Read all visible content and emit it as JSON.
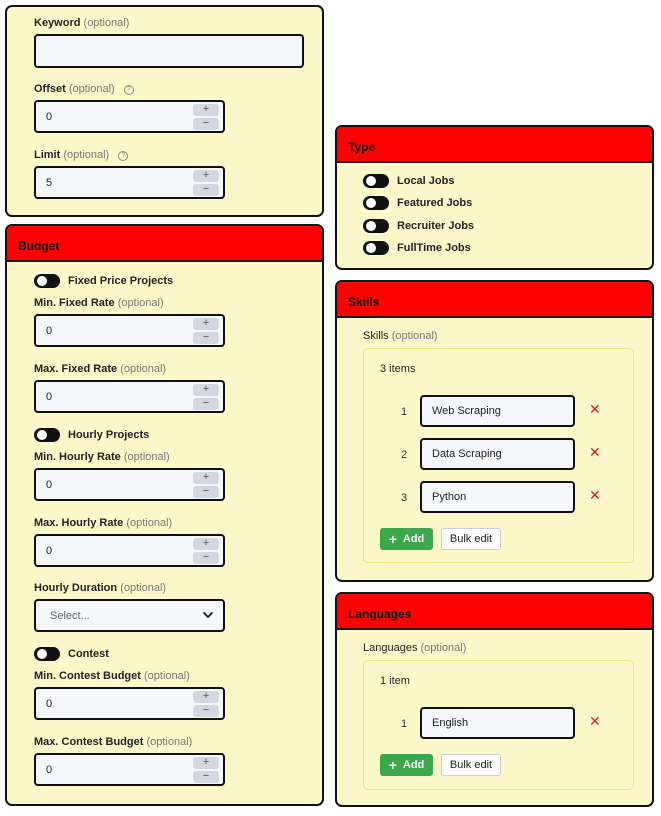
{
  "search": {
    "keyword": {
      "label": "Keyword",
      "optional": "(optional)",
      "value": ""
    },
    "offset": {
      "label": "Offset",
      "optional": "(optional)",
      "value": "0"
    },
    "limit": {
      "label": "Limit",
      "optional": "(optional)",
      "value": "5"
    }
  },
  "stepper": {
    "plus": "+",
    "minus": "−"
  },
  "help_glyph": "?",
  "budget": {
    "title": "Budget",
    "fixed_toggle": "Fixed Price Projects",
    "min_fixed": {
      "label": "Min. Fixed Rate",
      "optional": "(optional)",
      "value": "0"
    },
    "max_fixed": {
      "label": "Max. Fixed Rate",
      "optional": "(optional)",
      "value": "0"
    },
    "hourly_toggle": "Hourly Projects",
    "min_hourly": {
      "label": "Min. Hourly Rate",
      "optional": "(optional)",
      "value": "0"
    },
    "max_hourly": {
      "label": "Max. Hourly Rate",
      "optional": "(optional)",
      "value": "0"
    },
    "hourly_duration": {
      "label": "Hourly Duration",
      "optional": "(optional)",
      "placeholder": "Select..."
    },
    "contest_toggle": "Contest",
    "min_contest": {
      "label": "Min. Contest Budget",
      "optional": "(optional)",
      "value": "0"
    },
    "max_contest": {
      "label": "Max. Contest Budget",
      "optional": "(optional)",
      "value": "0"
    }
  },
  "type": {
    "title": "Type",
    "toggles": [
      "Local Jobs",
      "Featured Jobs",
      "Recruiter Jobs",
      "FullTime Jobs"
    ]
  },
  "skills": {
    "title": "Skills",
    "label": "Skills",
    "optional": "(optional)",
    "count": "3 items",
    "items": [
      {
        "num": "1",
        "value": "Web Scraping"
      },
      {
        "num": "2",
        "value": "Data Scraping"
      },
      {
        "num": "3",
        "value": "Python"
      }
    ],
    "add_label": "Add",
    "bulk_label": "Bulk edit"
  },
  "languages": {
    "title": "Languages",
    "label": "Languages",
    "optional": "(optional)",
    "count": "1 item",
    "items": [
      {
        "num": "1",
        "value": "English"
      }
    ],
    "add_label": "Add",
    "bulk_label": "Bulk edit"
  },
  "icons": {
    "remove": "✕",
    "plus": "+",
    "chevron": "chevron-down-icon"
  },
  "colors": {
    "header": "#ff0000",
    "card": "#fdf8c9",
    "add_button": "#3aa84b",
    "remove": "#e01a1a"
  }
}
